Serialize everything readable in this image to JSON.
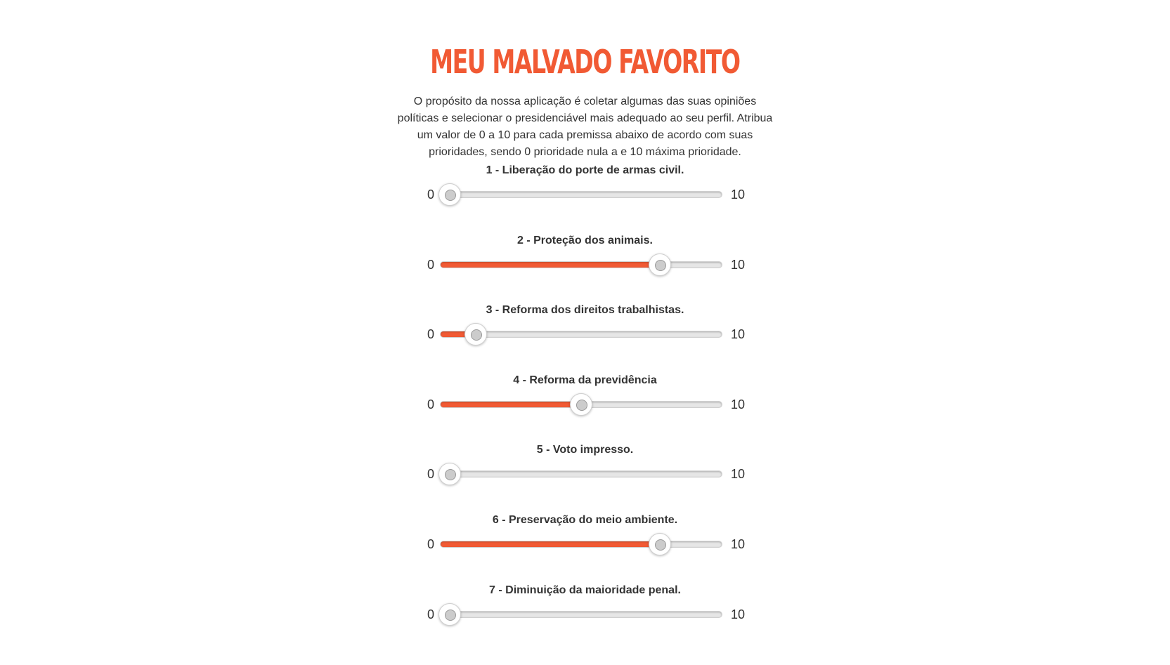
{
  "header": {
    "title": "MEU MALVADO FAVORITO",
    "intro": "O propósito da nossa aplicação é coletar algumas das suas opiniões políticas e selecionar o presidenciável mais adequado ao seu perfil. Atribua um valor de 0 a 10 para cada premissa abaixo de acordo com suas prioridades, sendo 0 prioridade nula a e 10 máxima prioridade."
  },
  "colors": {
    "accent": "#f15a34",
    "track": "#e6e6e6",
    "text": "#333333"
  },
  "questions": [
    {
      "label": "1 - Liberação do porte de armas civil.",
      "min": "0",
      "max": "10",
      "value": 0
    },
    {
      "label": "2 - Proteção dos animais.",
      "min": "0",
      "max": "10",
      "value": 8
    },
    {
      "label": "3 - Reforma dos direitos trabalhistas.",
      "min": "0",
      "max": "10",
      "value": 1
    },
    {
      "label": "4 - Reforma da previdência",
      "min": "0",
      "max": "10",
      "value": 5
    },
    {
      "label": "5 - Voto impresso.",
      "min": "0",
      "max": "10",
      "value": 0
    },
    {
      "label": "6 - Preservação do meio ambiente.",
      "min": "0",
      "max": "10",
      "value": 8
    },
    {
      "label": "7 - Diminuição da maioridade penal.",
      "min": "0",
      "max": "10",
      "value": 0
    }
  ]
}
